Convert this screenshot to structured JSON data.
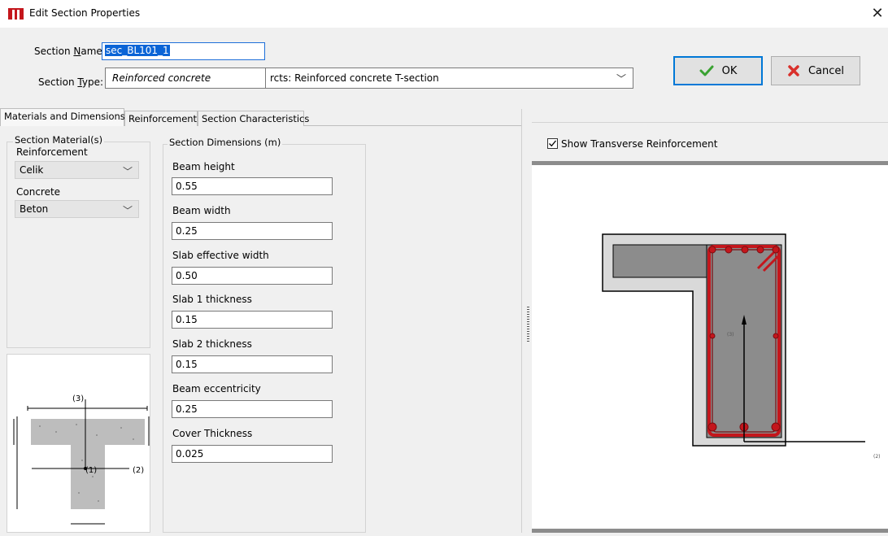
{
  "window": {
    "title": "Edit Section Properties"
  },
  "header": {
    "name_label_pre": "Section ",
    "name_label_u": "N",
    "name_label_post": "ame:",
    "name_value": "sec_BL101_1",
    "type_label_pre": "Section ",
    "type_label_u": "T",
    "type_label_post": "ype:",
    "type_category": "Reinforced concrete",
    "type_value": "rcts: Reinforced concrete T-section"
  },
  "buttons": {
    "ok": "OK",
    "cancel": "Cancel"
  },
  "tabs": [
    {
      "label": "Materials and Dimensions",
      "active": true
    },
    {
      "label": "Reinforcement",
      "active": false
    },
    {
      "label": "Section Characteristics",
      "active": false
    }
  ],
  "materials": {
    "group_title": "Section Material(s)",
    "reinforcement_label": "Reinforcement",
    "reinforcement_value": "Celik",
    "concrete_label": "Concrete",
    "concrete_value": "Beton"
  },
  "dimensions": {
    "group_title": "Section Dimensions (m)",
    "fields": [
      {
        "label": "Beam height",
        "value": "0.55"
      },
      {
        "label": "Beam width",
        "value": "0.25"
      },
      {
        "label": "Slab effective width",
        "value": "0.50"
      },
      {
        "label": "Slab 1 thickness",
        "value": "0.15"
      },
      {
        "label": "Slab 2 thickness",
        "value": "0.15"
      },
      {
        "label": "Beam eccentricity",
        "value": "0.25"
      },
      {
        "label": "Cover Thickness",
        "value": "0.025"
      }
    ]
  },
  "preview": {
    "axis_3": "(3)",
    "axis_1": "(1)",
    "axis_2": "(2)"
  },
  "viewer": {
    "show_transverse_label": "Show Transverse Reinforcement",
    "show_transverse_checked": true,
    "axis_3": "(3)",
    "axis_2": "(2)"
  },
  "colors": {
    "concrete_fill": "#d9d9d9",
    "inner_fill": "#8c8c8c",
    "rebar": "#c4161c",
    "accent": "#0078d7"
  }
}
